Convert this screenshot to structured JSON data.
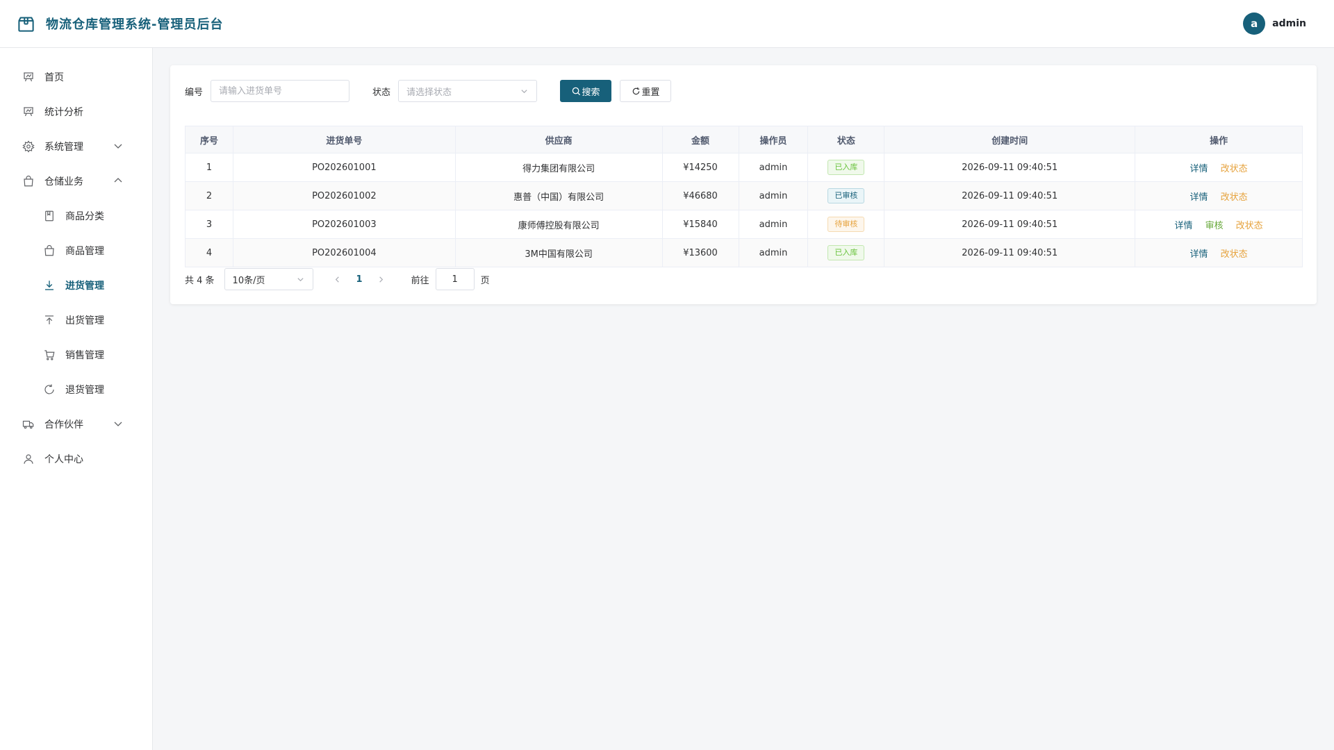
{
  "header": {
    "title": "物流仓库管理系统-管理员后台",
    "user": {
      "avatar_letter": "a",
      "name": "admin"
    }
  },
  "sidebar": {
    "items": [
      {
        "label": "首页",
        "icon": "home-icon"
      },
      {
        "label": "统计分析",
        "icon": "chart-icon"
      },
      {
        "label": "系统管理",
        "icon": "gear-icon",
        "expanded": false
      },
      {
        "label": "仓储业务",
        "icon": "bag-icon",
        "expanded": true
      },
      {
        "label": "商品分类",
        "icon": "book-icon",
        "sub": true
      },
      {
        "label": "商品管理",
        "icon": "shopping-bag-icon",
        "sub": true
      },
      {
        "label": "进货管理",
        "icon": "download-icon",
        "sub": true,
        "active": true
      },
      {
        "label": "出货管理",
        "icon": "upload-icon",
        "sub": true
      },
      {
        "label": "销售管理",
        "icon": "cart-icon",
        "sub": true
      },
      {
        "label": "退货管理",
        "icon": "refresh-icon",
        "sub": true
      },
      {
        "label": "合作伙伴",
        "icon": "truck-icon",
        "expanded": false
      },
      {
        "label": "个人中心",
        "icon": "user-icon"
      }
    ]
  },
  "search": {
    "code_label": "编号",
    "code_placeholder": "请输入进货单号",
    "status_label": "状态",
    "status_placeholder": "请选择状态",
    "search_button": "搜索",
    "reset_button": "重置"
  },
  "table": {
    "columns": [
      "序号",
      "进货单号",
      "供应商",
      "金额",
      "操作员",
      "状态",
      "创建时间",
      "操作"
    ],
    "rows": [
      {
        "index": "1",
        "code": "PO202601001",
        "supplier": "得力集团有限公司",
        "amount": "¥14250",
        "operator": "admin",
        "status": "已入库",
        "status_color": "green",
        "created": "2026-09-11 09:40:51",
        "actions": [
          "详情",
          "改状态"
        ]
      },
      {
        "index": "2",
        "code": "PO202601002",
        "supplier": "惠普（中国）有限公司",
        "amount": "¥46680",
        "operator": "admin",
        "status": "已审核",
        "status_color": "blue",
        "created": "2026-09-11 09:40:51",
        "actions": [
          "详情",
          "改状态"
        ]
      },
      {
        "index": "3",
        "code": "PO202601003",
        "supplier": "康师傅控股有限公司",
        "amount": "¥15840",
        "operator": "admin",
        "status": "待审核",
        "status_color": "orange",
        "created": "2026-09-11 09:40:51",
        "actions": [
          "详情",
          "审核",
          "改状态"
        ]
      },
      {
        "index": "4",
        "code": "PO202601004",
        "supplier": "3M中国有限公司",
        "amount": "¥13600",
        "operator": "admin",
        "status": "已入库",
        "status_color": "green",
        "created": "2026-09-11 09:40:51",
        "actions": [
          "详情",
          "改状态"
        ]
      }
    ]
  },
  "pagination": {
    "total": "共 4 条",
    "page_size": "10条/页",
    "current_page": "1",
    "goto_label": "前往",
    "goto_value": "1",
    "page_unit": "页"
  },
  "colors": {
    "brand": "#17607a",
    "tag_green": "#67c23a",
    "tag_orange": "#e6a23c"
  }
}
